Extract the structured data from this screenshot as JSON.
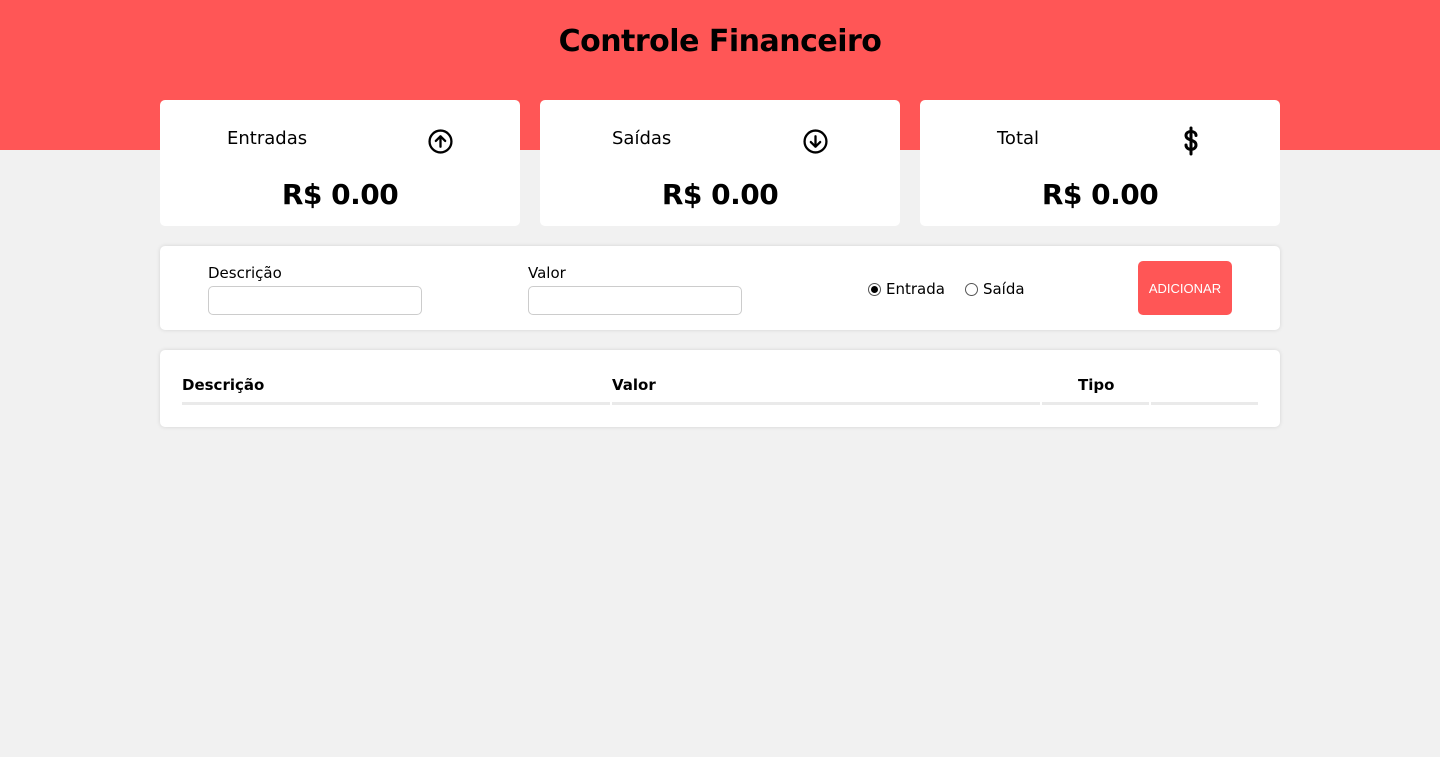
{
  "header": {
    "title": "Controle Financeiro"
  },
  "cards": [
    {
      "label": "Entradas",
      "icon": "arrow-up-circle-icon",
      "amount": "R$ 0.00"
    },
    {
      "label": "Saídas",
      "icon": "arrow-down-circle-icon",
      "amount": "R$ 0.00"
    },
    {
      "label": "Total",
      "icon": "dollar-icon",
      "amount": "R$ 0.00"
    }
  ],
  "form": {
    "description_label": "Descrição",
    "description_value": "",
    "value_label": "Valor",
    "value_value": "",
    "radio_entrada": "Entrada",
    "radio_saida": "Saída",
    "selected_type": "Entrada",
    "add_button": "ADICIONAR"
  },
  "table": {
    "headers": [
      "Descrição",
      "Valor",
      "Tipo",
      ""
    ],
    "rows": []
  },
  "colors": {
    "accent": "#ff5656",
    "background": "#f1f1f1"
  }
}
